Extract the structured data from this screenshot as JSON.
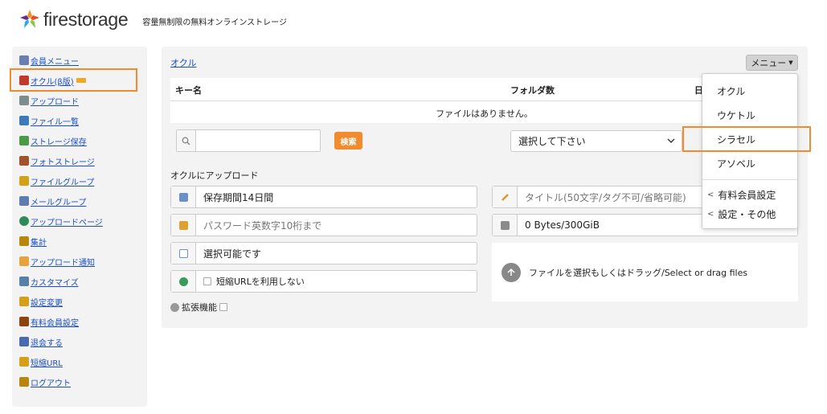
{
  "header": {
    "logo_text": "firestorage",
    "tagline": "容量無制限の無料オンラインストレージ"
  },
  "sidebar": {
    "items": [
      {
        "label": "会員メニュー",
        "icon": "member-icon",
        "color": "#6a7fb0"
      },
      {
        "label": "オクル(β版)",
        "icon": "okuru-icon",
        "color": "#c0392b"
      },
      {
        "label": "アップロード",
        "icon": "upload-icon",
        "color": "#7f8c8d"
      },
      {
        "label": "ファイル一覧",
        "icon": "file-list-icon",
        "color": "#3d7ab8"
      },
      {
        "label": "ストレージ保存",
        "icon": "storage-icon",
        "color": "#4a9a4a"
      },
      {
        "label": "フォトストレージ",
        "icon": "photo-icon",
        "color": "#a0522d"
      },
      {
        "label": "ファイルグループ",
        "icon": "file-group-icon",
        "color": "#d4a017"
      },
      {
        "label": "メールグループ",
        "icon": "mail-group-icon",
        "color": "#5b7db0"
      },
      {
        "label": "アップロードページ",
        "icon": "globe-icon",
        "color": "#2e8b57"
      },
      {
        "label": "集計",
        "icon": "chart-icon",
        "color": "#b8860b"
      },
      {
        "label": "アップロード通知",
        "icon": "bell-icon",
        "color": "#e6a23c"
      },
      {
        "label": "カスタマイズ",
        "icon": "wrench-icon",
        "color": "#5a7fa8"
      },
      {
        "label": "設定変更",
        "icon": "key-icon",
        "color": "#d4a017"
      },
      {
        "label": "有料会員設定",
        "icon": "premium-member-icon",
        "color": "#8b4513"
      },
      {
        "label": "退会する",
        "icon": "leave-icon",
        "color": "#4a6ab0"
      },
      {
        "label": "短縮URL",
        "icon": "short-url-icon",
        "color": "#d4a017"
      },
      {
        "label": "ログアウト",
        "icon": "logout-icon",
        "color": "#b8860b"
      }
    ]
  },
  "main": {
    "breadcrumb": "オクル",
    "menu_button": "メニュー",
    "table": {
      "col_key": "キー名",
      "col_folders": "フォルダ数",
      "col_partial": "日",
      "empty": "ファイルはありません。"
    },
    "search": {
      "value": "",
      "button": "検索"
    },
    "select": {
      "selected": "選択して下さい"
    },
    "upload_title": "オクルにアップロード",
    "fields": {
      "period": "保存期間14日間",
      "password_placeholder": "パスワード英数字10桁まで",
      "selectable": "選択可能です",
      "short_url": "短縮URLを利用しない",
      "title_placeholder": "タイトル(50文字/タグ不可/省略可能)",
      "size": "0 Bytes/300GiB"
    },
    "extension": "拡張機能",
    "drop_text": "ファイルを選択もしくはドラッグ/Select or drag files"
  },
  "dropdown": {
    "items": [
      "オクル",
      "ウケトル",
      "シラセル",
      "アソベル"
    ],
    "sub_items": [
      "有料会員設定",
      "設定・その他"
    ]
  },
  "colors": {
    "accent": "#f28a2e",
    "link": "#1a4fc4"
  }
}
